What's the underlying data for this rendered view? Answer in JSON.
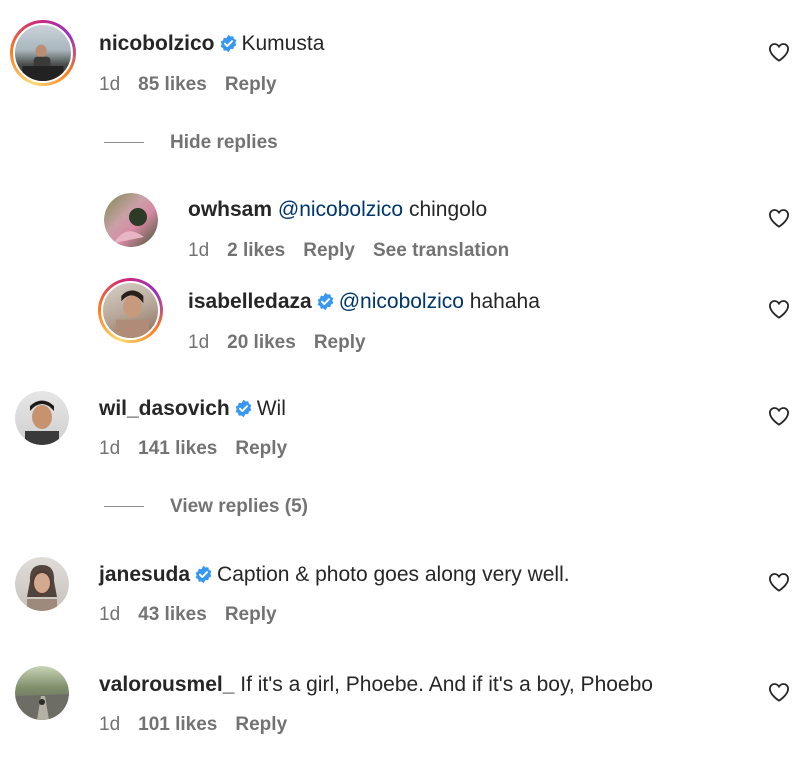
{
  "comments": [
    {
      "username": "nicobolzico",
      "verified": true,
      "mention": "",
      "text": "Kumusta",
      "age": "1d",
      "likes": "85 likes",
      "reply": "Reply",
      "toggle": "Hide replies"
    },
    {
      "username": "owhsam",
      "verified": false,
      "mention": "@nicobolzico",
      "text": "chingolo",
      "age": "1d",
      "likes": "2 likes",
      "reply": "Reply",
      "translate": "See translation"
    },
    {
      "username": "isabelledaza",
      "verified": true,
      "mention": "@nicobolzico",
      "text": "hahaha",
      "age": "1d",
      "likes": "20 likes",
      "reply": "Reply"
    },
    {
      "username": "wil_dasovich",
      "verified": true,
      "mention": "",
      "text": "Wil",
      "age": "1d",
      "likes": "141 likes",
      "reply": "Reply",
      "toggle": "View replies (5)"
    },
    {
      "username": "janesuda",
      "verified": true,
      "mention": "",
      "text": "Caption & photo goes along very well.",
      "age": "1d",
      "likes": "43 likes",
      "reply": "Reply"
    },
    {
      "username": "valorousmel_",
      "verified": false,
      "mention": "",
      "text": "If it's a girl, Phoebe. And if it's a boy, Phoebo",
      "age": "1d",
      "likes": "101 likes",
      "reply": "Reply"
    }
  ],
  "colors": {
    "verified_badge": "#3897f0",
    "mention": "#00376b",
    "secondary_text": "#737373",
    "primary_text": "#262626"
  },
  "icons": {
    "like": "heart-outline-icon",
    "verified": "verified-badge-icon"
  }
}
